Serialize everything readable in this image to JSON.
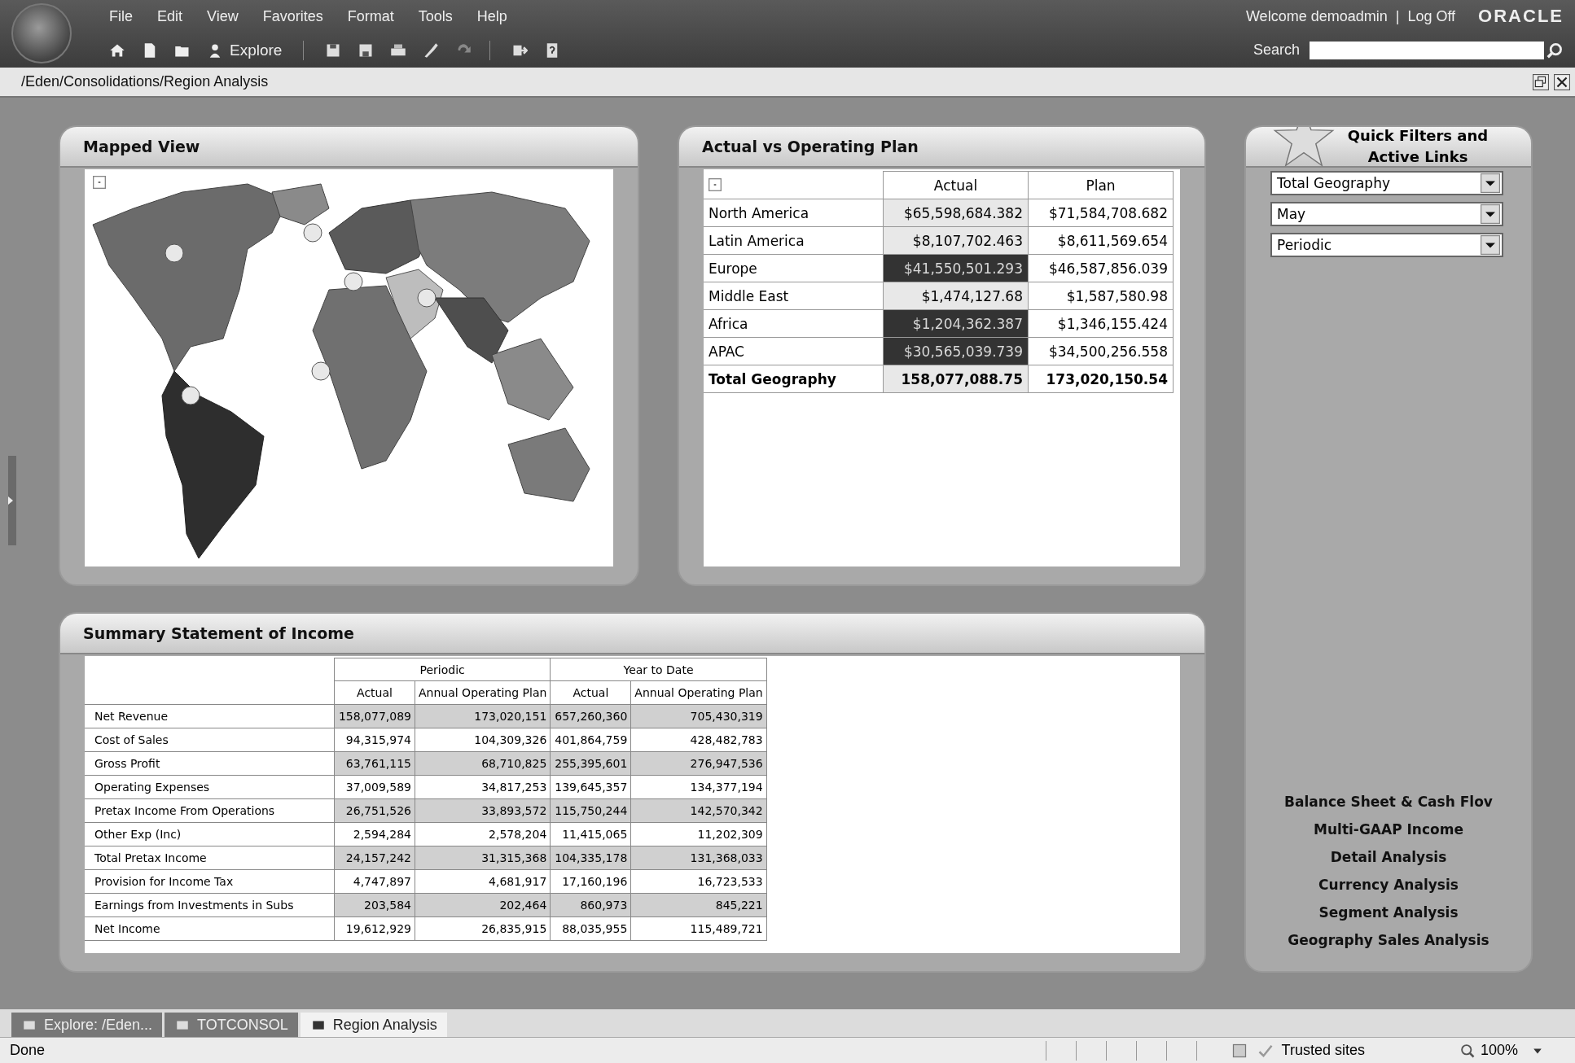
{
  "menu": [
    {
      "label": "File"
    },
    {
      "label": "Edit"
    },
    {
      "label": "View"
    },
    {
      "label": "Favorites"
    },
    {
      "label": "Format"
    },
    {
      "label": "Tools"
    },
    {
      "label": "Help"
    }
  ],
  "welcome": "Welcome demoadmin",
  "separator": "|",
  "logoff": "Log Off",
  "brand": "ORACLE",
  "toolbar": {
    "explore_label": "Explore"
  },
  "search": {
    "label": "Search"
  },
  "path": "/Eden/Consolidations/Region Analysis",
  "mapped_view": {
    "title": "Mapped View"
  },
  "actual_vs_plan": {
    "title": "Actual vs Operating Plan",
    "columns": [
      "Actual",
      "Plan"
    ],
    "rows": [
      {
        "label": "North America",
        "actual": "$65,598,684.382",
        "plan": "$71,584,708.682",
        "highlighted": false
      },
      {
        "label": "Latin America",
        "actual": "$8,107,702.463",
        "plan": "$8,611,569.654",
        "highlighted": false
      },
      {
        "label": "Europe",
        "actual": "$41,550,501.293",
        "plan": "$46,587,856.039",
        "highlighted": true
      },
      {
        "label": "Middle East",
        "actual": "$1,474,127.68",
        "plan": "$1,587,580.98",
        "highlighted": false
      },
      {
        "label": "Africa",
        "actual": "$1,204,362.387",
        "plan": "$1,346,155.424",
        "highlighted": true
      },
      {
        "label": "APAC",
        "actual": "$30,565,039.739",
        "plan": "$34,500,256.558",
        "highlighted": true
      }
    ],
    "total": {
      "label": "Total Geography",
      "actual": "158,077,088.75",
      "plan": "173,020,150.54"
    }
  },
  "quick_filters": {
    "title": "Quick Filters and Active Links",
    "dropdowns": [
      "Total Geography",
      "May",
      "Periodic"
    ],
    "links": [
      "Balance Sheet & Cash Flov",
      "Multi-GAAP Income",
      "Detail Analysis",
      "Currency Analysis",
      "Segment Analysis",
      "Geography Sales Analysis"
    ]
  },
  "summary": {
    "title": "Summary Statement of Income",
    "groups": [
      "Periodic",
      "Year to Date"
    ],
    "columns": [
      "Actual",
      "Annual Operating Plan",
      "Actual",
      "Annual Operating Plan"
    ],
    "rows": [
      {
        "label": "Net Revenue",
        "values": [
          "158,077,089",
          "173,020,151",
          "657,260,360",
          "705,430,319"
        ],
        "shaded": true
      },
      {
        "label": "Cost of Sales",
        "values": [
          "94,315,974",
          "104,309,326",
          "401,864,759",
          "428,482,783"
        ],
        "shaded": false
      },
      {
        "label": "Gross Profit",
        "values": [
          "63,761,115",
          "68,710,825",
          "255,395,601",
          "276,947,536"
        ],
        "shaded": true
      },
      {
        "label": "Operating Expenses",
        "values": [
          "37,009,589",
          "34,817,253",
          "139,645,357",
          "134,377,194"
        ],
        "shaded": false
      },
      {
        "label": "Pretax Income From Operations",
        "values": [
          "26,751,526",
          "33,893,572",
          "115,750,244",
          "142,570,342"
        ],
        "shaded": true
      },
      {
        "label": "Other Exp (Inc)",
        "values": [
          "2,594,284",
          "2,578,204",
          "11,415,065",
          "11,202,309"
        ],
        "shaded": false
      },
      {
        "label": "Total Pretax Income",
        "values": [
          "24,157,242",
          "31,315,368",
          "104,335,178",
          "131,368,033"
        ],
        "shaded": true
      },
      {
        "label": "Provision for Income Tax",
        "values": [
          "4,747,897",
          "4,681,917",
          "17,160,196",
          "16,723,533"
        ],
        "shaded": false
      },
      {
        "label": "Earnings from Investments in Subs",
        "values": [
          "203,584",
          "202,464",
          "860,973",
          "845,221"
        ],
        "shaded": true
      },
      {
        "label": "Net Income",
        "values": [
          "19,612,929",
          "26,835,915",
          "88,035,955",
          "115,489,721"
        ],
        "shaded": false
      }
    ]
  },
  "tabs": [
    {
      "label": "Explore: /Eden...",
      "selected": false
    },
    {
      "label": "TOTCONSOL",
      "selected": false
    },
    {
      "label": "Region Analysis",
      "selected": true
    }
  ],
  "status_bar": {
    "text": "Done",
    "zone": "Trusted sites",
    "zoom": "100%"
  }
}
